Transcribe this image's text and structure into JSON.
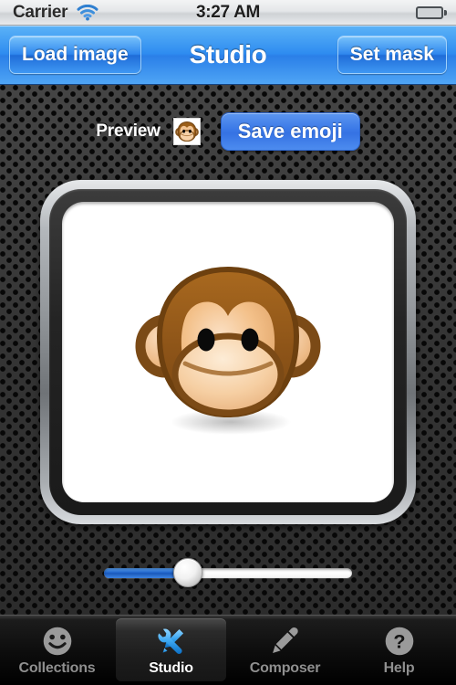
{
  "statusbar": {
    "carrier": "Carrier",
    "time": "3:27 AM",
    "wifi_icon": "wifi-icon",
    "battery_icon": "battery-icon",
    "battery_color": "#57c115"
  },
  "navbar": {
    "title": "Studio",
    "left_button": "Load image",
    "right_button": "Set mask",
    "accent_color": "#2e8cf0"
  },
  "toolbar": {
    "preview_label": "Preview",
    "preview_thumb_icon": "monkey-emoji-thumbnail",
    "save_button": "Save emoji",
    "save_button_color": "#3a78e7"
  },
  "canvas": {
    "image_name": "monkey-emoji",
    "background_color": "#ffffff",
    "frame_color": "#8e9296"
  },
  "slider": {
    "name": "zoom-slider",
    "value_percent": 34,
    "min": 0,
    "max": 100,
    "fill_color": "#1d62c9"
  },
  "tabbar": {
    "active_index": 1,
    "tabs": [
      {
        "label": "Collections",
        "icon": "smiley-face-icon",
        "active": false
      },
      {
        "label": "Studio",
        "icon": "wrench-pencil-icon",
        "active": true
      },
      {
        "label": "Composer",
        "icon": "pen-icon",
        "active": false
      },
      {
        "label": "Help",
        "icon": "question-mark-circle-icon",
        "active": false
      }
    ]
  }
}
